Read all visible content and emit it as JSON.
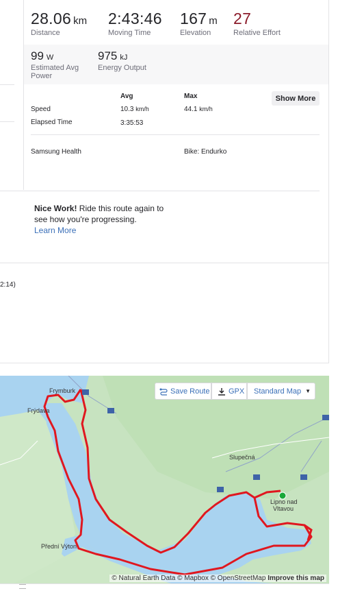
{
  "stats_top": [
    {
      "value": "28.06",
      "unit": "km",
      "label": "Distance"
    },
    {
      "value": "2:43:46",
      "unit": "",
      "label": "Moving Time"
    },
    {
      "value": "167",
      "unit": "m",
      "label": "Elevation"
    },
    {
      "value": "27",
      "unit": "",
      "label": "Relative Effort"
    }
  ],
  "stats_second": [
    {
      "value": "99",
      "unit": "W",
      "label": "Estimated Avg Power"
    },
    {
      "value": "975",
      "unit": "kJ",
      "label": "Energy Output"
    }
  ],
  "table": {
    "col_avg": "Avg",
    "col_max": "Max",
    "show_more": "Show More",
    "rows": [
      {
        "label": "Speed",
        "avg": "10.3",
        "avg_unit": "km/h",
        "max": "44.1",
        "max_unit": "km/h"
      },
      {
        "label": "Elapsed Time",
        "avg": "3:35:53",
        "avg_unit": "",
        "max": "",
        "max_unit": ""
      }
    ]
  },
  "device": "Samsung Health",
  "bike": "Bike: Endurko",
  "nice_work": {
    "bold": "Nice Work!",
    "text": " Ride this route again to see how you're progressing.",
    "link": "Learn More"
  },
  "partial_text": "2:14)",
  "map": {
    "save_route": "Save Route",
    "gpx": "GPX",
    "map_type": "Standard Map",
    "attribution": "© Natural Earth Data © Mapbox © OpenStreetMap",
    "improve": "Improve this map",
    "places": [
      "Frymburk",
      "Frýdava",
      "Slupečná",
      "Lipno nad",
      "Vltavou",
      "Přední Výton"
    ]
  },
  "colors": {
    "route": "#e0171f",
    "water": "#a9d3f0",
    "land": "#c9e5c2",
    "effort": "#8b1b2a",
    "link": "#3a6fb8"
  }
}
